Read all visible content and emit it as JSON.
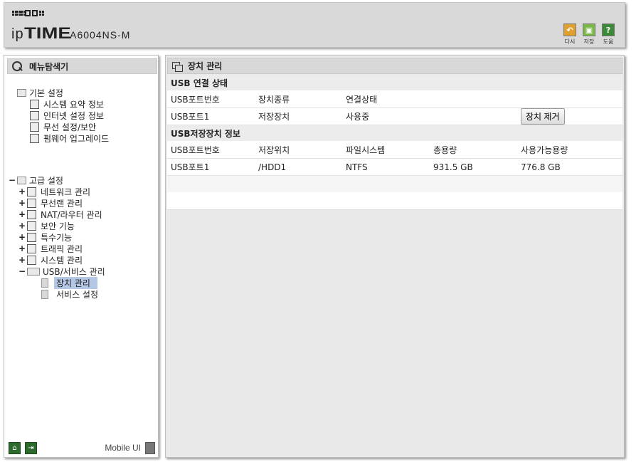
{
  "header": {
    "brand_ip": "ip",
    "brand_time": "TIME",
    "model": "A6004NS-M",
    "buttons": [
      {
        "label": "다시",
        "icon": "undo-icon",
        "color": "#e0a030"
      },
      {
        "label": "저장",
        "icon": "save-icon",
        "color": "#7ab648"
      },
      {
        "label": "도움",
        "icon": "help-icon",
        "color": "#3a8a3a"
      }
    ]
  },
  "sidebar": {
    "title": "메뉴탐색기",
    "basic": {
      "label": "기본 설정",
      "items": [
        "시스템 요약 정보",
        "인터넷 설정 정보",
        "무선 설정/보안",
        "펌웨어 업그레이드"
      ]
    },
    "advanced": {
      "toggle": "−",
      "label": "고급 설정",
      "items": [
        {
          "pm": "+",
          "label": "네트워크 관리"
        },
        {
          "pm": "+",
          "label": "무선랜 관리"
        },
        {
          "pm": "+",
          "label": "NAT/라우터 관리"
        },
        {
          "pm": "+",
          "label": "보안 기능"
        },
        {
          "pm": "+",
          "label": "특수기능"
        },
        {
          "pm": "+",
          "label": "트래픽 관리"
        },
        {
          "pm": "+",
          "label": "시스템 관리"
        },
        {
          "pm": "−",
          "label": "USB/서비스 관리"
        }
      ],
      "sub_items": [
        "장치 관리",
        "서비스 설정"
      ]
    },
    "mobile_label": "Mobile UI"
  },
  "main": {
    "title": "장치 관리",
    "usb_status": {
      "section_title": "USB 연결 상태",
      "headers": [
        "USB포트번호",
        "장치종류",
        "연결상태"
      ],
      "rows": [
        {
          "port": "USB포트1",
          "type": "저장장치",
          "status": "사용중",
          "action": "장치 제거"
        }
      ]
    },
    "usb_storage": {
      "section_title": "USB저장장치 정보",
      "headers": [
        "USB포트번호",
        "저장위치",
        "파일시스템",
        "총용량",
        "사용가능용량"
      ],
      "rows": [
        {
          "port": "USB포트1",
          "location": "/HDD1",
          "fs": "NTFS",
          "total": "931.5 GB",
          "free": "776.8 GB"
        }
      ]
    }
  }
}
